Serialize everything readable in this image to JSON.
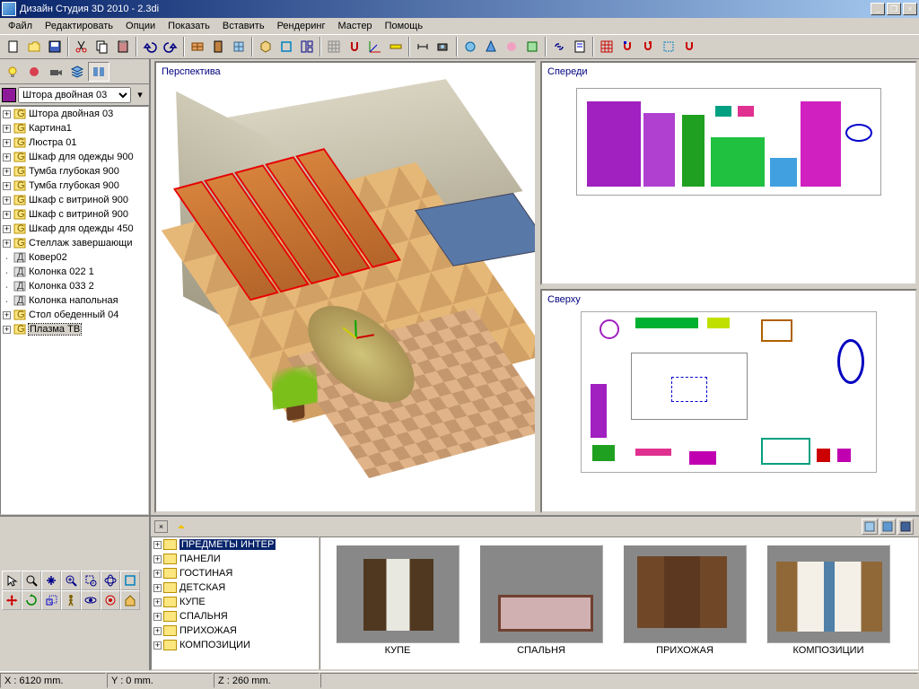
{
  "window": {
    "title": "Дизайн Студия 3D 2010 - 2.3di"
  },
  "menu": [
    "Файл",
    "Редактировать",
    "Опции",
    "Показать",
    "Вставить",
    "Рендеринг",
    "Мастер",
    "Помощь"
  ],
  "combo": {
    "selected": "Штора двойная 03"
  },
  "sceneTree": [
    {
      "exp": "+",
      "ic": "g",
      "label": "Штора двойная 03"
    },
    {
      "exp": "+",
      "ic": "g",
      "label": "Картина1"
    },
    {
      "exp": "+",
      "ic": "g",
      "label": "Люстра 01"
    },
    {
      "exp": "+",
      "ic": "g",
      "label": "Шкаф для одежды 900"
    },
    {
      "exp": "+",
      "ic": "g",
      "label": "Тумба глубокая 900"
    },
    {
      "exp": "+",
      "ic": "g",
      "label": "Тумба глубокая 900"
    },
    {
      "exp": "+",
      "ic": "g",
      "label": "Шкаф с витриной 900"
    },
    {
      "exp": "+",
      "ic": "g",
      "label": "Шкаф с витриной 900"
    },
    {
      "exp": "+",
      "ic": "g",
      "label": "Шкаф для одежды 450"
    },
    {
      "exp": "+",
      "ic": "g",
      "label": "Стеллаж завершающи"
    },
    {
      "exp": "",
      "ic": "d",
      "label": "Ковер02"
    },
    {
      "exp": "",
      "ic": "d",
      "label": "Колонка 022 1"
    },
    {
      "exp": "",
      "ic": "d",
      "label": "Колонка 033 2"
    },
    {
      "exp": "",
      "ic": "d",
      "label": "Колонка напольная"
    },
    {
      "exp": "+",
      "ic": "g",
      "label": "Стол обеденный 04"
    },
    {
      "exp": "+",
      "ic": "g",
      "label": "Плазма ТВ",
      "sel": true
    }
  ],
  "viewports": {
    "perspective": "Перспектива",
    "front": "Спереди",
    "top": "Сверху"
  },
  "catalogTree": [
    {
      "label": "ПРЕДМЕТЫ ИНТЕР",
      "sel": true
    },
    {
      "label": "ПАНЕЛИ"
    },
    {
      "label": "ГОСТИНАЯ"
    },
    {
      "label": "ДЕТСКАЯ"
    },
    {
      "label": "КУПЕ"
    },
    {
      "label": "СПАЛЬНЯ"
    },
    {
      "label": "ПРИХОЖАЯ"
    },
    {
      "label": "КОМПОЗИЦИИ"
    }
  ],
  "gallery": [
    {
      "caption": "КУПЕ"
    },
    {
      "caption": "СПАЛЬНЯ"
    },
    {
      "caption": "ПРИХОЖАЯ"
    },
    {
      "caption": "КОМПОЗИЦИИ"
    }
  ],
  "status": {
    "x": "X : 6120 mm.",
    "y": "Y : 0 mm.",
    "z": "Z : 260 mm."
  }
}
